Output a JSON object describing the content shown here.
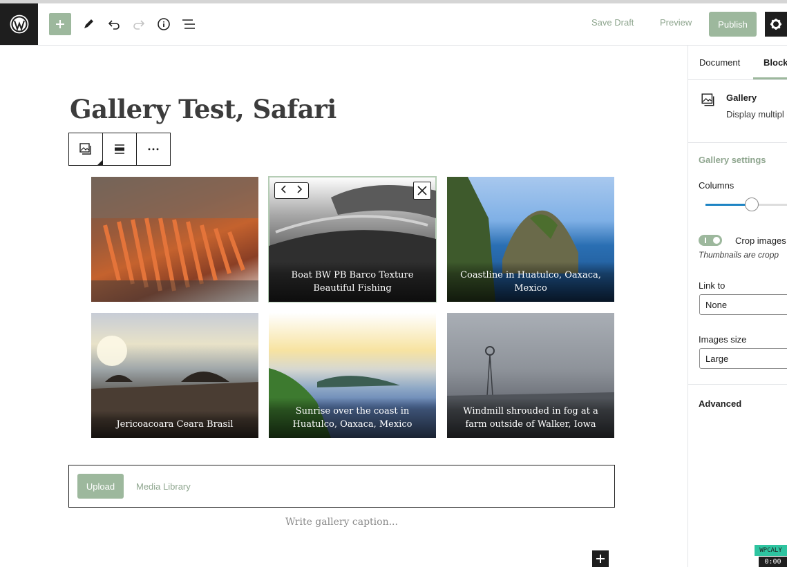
{
  "toolbar": {
    "save_draft": "Save Draft",
    "preview": "Preview",
    "publish": "Publish"
  },
  "post": {
    "title": "Gallery Test, Safari"
  },
  "gallery": {
    "items": [
      {
        "caption": ""
      },
      {
        "caption": "Boat BW PB Barco Texture Beautiful Fishing"
      },
      {
        "caption": "Coastline in Huatulco, Oaxaca, Mexico"
      },
      {
        "caption": "Jericoacoara Ceara Brasil"
      },
      {
        "caption": "Sunrise over the coast in Huatulco, Oaxaca, Mexico"
      },
      {
        "caption": "Windmill shrouded in fog at a farm outside of Walker, Iowa"
      }
    ],
    "upload": "Upload",
    "media_library": "Media Library",
    "caption_placeholder": "Write gallery caption..."
  },
  "sidebar": {
    "tabs": [
      "Document",
      "Block"
    ],
    "block_name": "Gallery",
    "block_desc": "Display multipl gallery.",
    "gallery_settings": "Gallery settings",
    "columns_label": "Columns",
    "crop_label": "Crop images",
    "crop_help": "Thumbnails are cropp",
    "link_to_label": "Link to",
    "link_to_value": "None",
    "images_size_label": "Images size",
    "images_size_value": "Large",
    "advanced": "Advanced"
  },
  "overlay": {
    "watermark": "WPCALY",
    "timer": "0:00"
  },
  "colors": {
    "accent": "#9db89d",
    "dark": "#1e1e1e",
    "slider": "#1e84c4"
  }
}
